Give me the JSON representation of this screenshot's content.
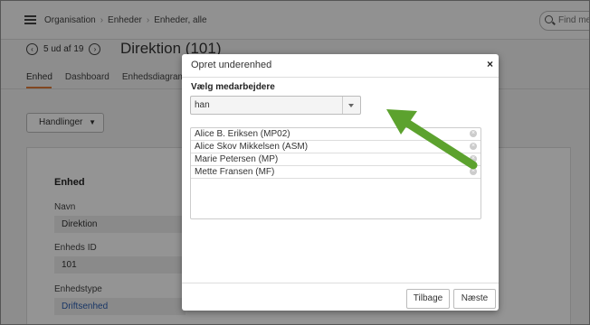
{
  "topbar": {
    "breadcrumbs": [
      "Organisation",
      "Enheder",
      "Enheder, alle"
    ],
    "search_placeholder": "Find med"
  },
  "header": {
    "pager_text": "5 ud af 19",
    "prev_icon": "chevron-left-icon",
    "next_icon": "chevron-right-icon",
    "title": "Direktion (101)"
  },
  "tabs": [
    "Enhed",
    "Dashboard",
    "Enhedsdiagram"
  ],
  "accent_color": "#e07b39",
  "actions_label": "Handlinger",
  "card": {
    "section_title": "Enhed",
    "fields": [
      {
        "label": "Navn",
        "value": "Direktion"
      },
      {
        "label": "Enheds ID",
        "value": "101"
      },
      {
        "label": "Enhedstype",
        "value": "Driftsenhed"
      }
    ]
  },
  "modal": {
    "title": "Opret underenhed",
    "close": "×",
    "select_label": "Vælg medarbejdere",
    "search_value": "han",
    "results": [
      "Alice B. Eriksen (MP02)",
      "Alice Skov Mikkelsen (ASM)",
      "Marie Petersen (MP)",
      "Mette Fransen (MF)"
    ],
    "back_label": "Tilbage",
    "next_label": "Næste"
  },
  "annotation_arrow_color": "#5ca22e"
}
